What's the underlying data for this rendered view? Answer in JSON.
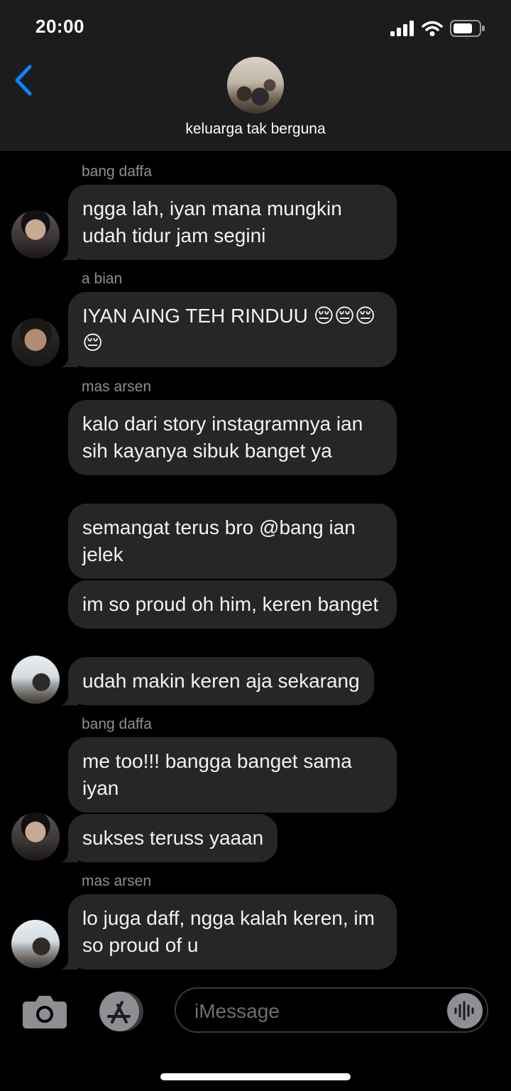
{
  "status": {
    "time": "20:00"
  },
  "chat": {
    "title": "keluarga tak berguna"
  },
  "messages": [
    {
      "sender": "bang daffa",
      "text": "ngga lah, iyan mana mungkin udah tidur jam segini"
    },
    {
      "sender": "a bian",
      "text": "IYAN AING TEH RINDUU 😔😔😔😔"
    },
    {
      "sender": "mas arsen",
      "text": "kalo dari story instagramnya ian sih kayanya sibuk banget ya"
    },
    {
      "text": "semangat terus bro @bang ian jelek"
    },
    {
      "text": "im so proud oh him, keren banget"
    },
    {
      "text": "udah makin keren aja sekarang"
    },
    {
      "sender": "bang daffa",
      "text": "me too!!! bangga banget sama iyan"
    },
    {
      "text": "sukses teruss yaaan"
    },
    {
      "sender": "mas arsen",
      "text": "lo juga daff, ngga kalah keren, im so proud of u"
    }
  ],
  "input": {
    "placeholder": "iMessage"
  },
  "icons": {
    "back": "chevron-left-icon",
    "camera": "camera-icon",
    "appstore": "appstore-icon",
    "audio": "audio-waveform-icon",
    "signal": "signal-icon",
    "wifi": "wifi-icon",
    "battery": "battery-icon"
  },
  "colors": {
    "accent": "#0a84ff",
    "bubble": "#262628",
    "background": "#000000",
    "header": "#1c1c1e",
    "secondary_text": "#8e8e93"
  }
}
